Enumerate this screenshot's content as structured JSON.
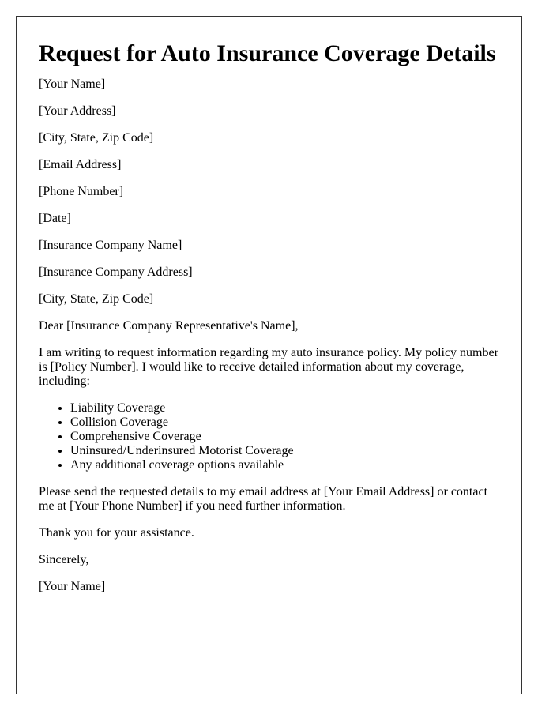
{
  "title": "Request for Auto Insurance Coverage Details",
  "sender": {
    "name": "[Your Name]",
    "address": "[Your Address]",
    "city_state_zip": "[City, State, Zip Code]",
    "email": "[Email Address]",
    "phone": "[Phone Number]",
    "date": "[Date]"
  },
  "recipient": {
    "company": "[Insurance Company Name]",
    "address": "[Insurance Company Address]",
    "city_state_zip": "[City, State, Zip Code]"
  },
  "salutation": "Dear [Insurance Company Representative's Name],",
  "body": {
    "intro": "I am writing to request information regarding my auto insurance policy. My policy number is [Policy Number]. I would like to receive detailed information about my coverage, including:",
    "coverage_items": [
      "Liability Coverage",
      "Collision Coverage",
      "Comprehensive Coverage",
      "Uninsured/Underinsured Motorist Coverage",
      "Any additional coverage options available"
    ],
    "request": "Please send the requested details to my email address at [Your Email Address] or contact me at [Your Phone Number] if you need further information.",
    "thanks": "Thank you for your assistance."
  },
  "closing": "Sincerely,",
  "signature": "[Your Name]"
}
